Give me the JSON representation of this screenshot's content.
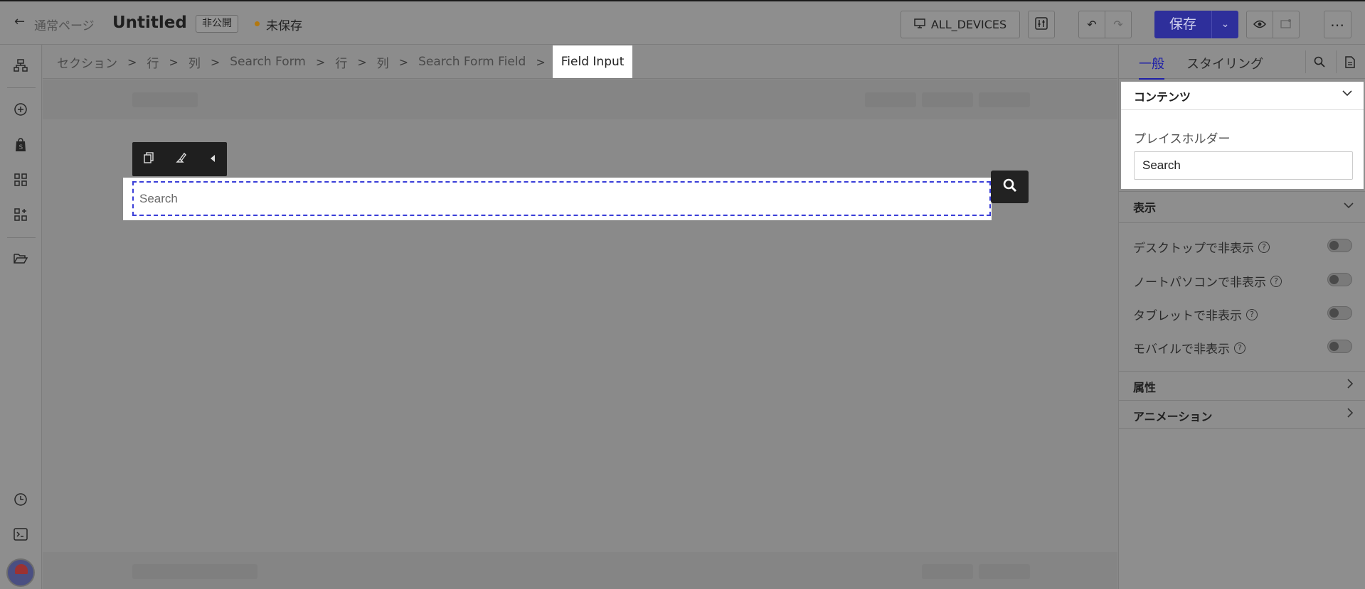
{
  "header": {
    "back_icon": "arrow-left-icon",
    "page_type": "通常ページ",
    "title": "Untitled",
    "visibility_badge": "非公開",
    "status": "未保存",
    "status_color": "#b3780f",
    "devices_label": "ALL_DEVICES",
    "save_label": "保存",
    "save_color": "#2e2f9b"
  },
  "rail": {
    "icons": [
      "sitemap-icon",
      "add-circle-icon",
      "shopify-icon",
      "grid-icon",
      "apps-add-icon",
      "folder-open-icon",
      "history-icon",
      "terminal-icon",
      "avatar"
    ]
  },
  "breadcrumb": {
    "items": [
      "セクション",
      "行",
      "列",
      "Search Form",
      "行",
      "列",
      "Search Form Field"
    ],
    "active": "Field Input"
  },
  "canvas": {
    "input_placeholder": "Search"
  },
  "panel": {
    "tabs": [
      "一般",
      "スタイリング"
    ],
    "content_section": "コンテンツ",
    "placeholder_label": "プレイスホルダー",
    "placeholder_value": "Search",
    "display_section": "表示",
    "toggles": [
      {
        "label": "デスクトップで非表示",
        "on": false
      },
      {
        "label": "ノートパソコンで非表示",
        "on": false
      },
      {
        "label": "タブレットで非表示",
        "on": false
      },
      {
        "label": "モバイルで非表示",
        "on": false
      }
    ],
    "attributes_section": "属性",
    "animation_section": "アニメーション"
  }
}
